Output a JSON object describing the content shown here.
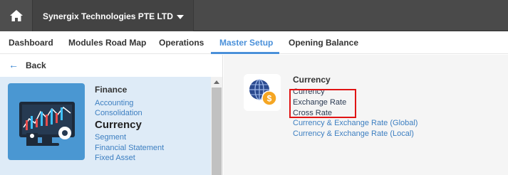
{
  "header": {
    "home_icon": "home-icon",
    "company_name": "Synergix Technologies PTE LTD",
    "company_dropdown_icon": "caret-down-icon"
  },
  "tabs": [
    {
      "label": "Dashboard",
      "active": false
    },
    {
      "label": "Modules Road Map",
      "active": false
    },
    {
      "label": "Operations",
      "active": false
    },
    {
      "label": "Master Setup",
      "active": true
    },
    {
      "label": "Opening Balance",
      "active": false
    }
  ],
  "sidebar": {
    "back_label": "Back",
    "back_icon": "arrow-left-icon",
    "card": {
      "title": "Finance",
      "thumbnail_icon": "finance-monitor-icon",
      "items": [
        {
          "label": "Accounting",
          "current": false
        },
        {
          "label": "Consolidation",
          "current": false
        },
        {
          "label": "Currency",
          "current": true
        },
        {
          "label": "Segment",
          "current": false
        },
        {
          "label": "Financial Statement",
          "current": false
        },
        {
          "label": "Fixed Asset",
          "current": false
        }
      ]
    }
  },
  "content": {
    "section_title": "Currency",
    "section_icon": "globe-dollar-icon",
    "items": [
      {
        "label": "Currency"
      },
      {
        "label": "Exchange Rate"
      },
      {
        "label": "Cross Rate"
      },
      {
        "label": "Currency & Exchange Rate (Global)"
      },
      {
        "label": "Currency & Exchange Rate (Local)"
      }
    ]
  },
  "colors": {
    "topbar": "#4a4a4a",
    "accent": "#4a90d9",
    "link": "#3d7fc1",
    "highlight": "#e01414",
    "card_bg": "#deebf7"
  }
}
